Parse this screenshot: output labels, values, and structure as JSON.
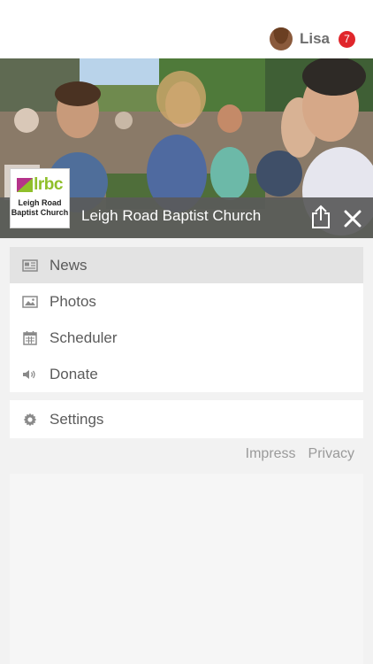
{
  "user": {
    "name": "Lisa",
    "notification_count": "7"
  },
  "organization": {
    "logo_text": "lrbc",
    "logo_name_line1": "Leigh Road",
    "logo_name_line2": "Baptist Church",
    "title": "Leigh Road Baptist Church"
  },
  "header_actions": {
    "share_icon": "share-icon",
    "close_icon": "close-icon"
  },
  "menu": {
    "items": [
      {
        "label": "News",
        "icon": "newspaper-icon",
        "active": true
      },
      {
        "label": "Photos",
        "icon": "image-icon",
        "active": false
      },
      {
        "label": "Scheduler",
        "icon": "calendar-icon",
        "active": false
      },
      {
        "label": "Donate",
        "icon": "speaker-icon",
        "active": false
      }
    ],
    "settings": {
      "label": "Settings",
      "icon": "gear-icon"
    }
  },
  "footer": {
    "impress": "Impress",
    "privacy": "Privacy"
  },
  "colors": {
    "badge": "#e0262b",
    "logo_green": "#8fbf2a",
    "logo_magenta": "#b5338a"
  }
}
